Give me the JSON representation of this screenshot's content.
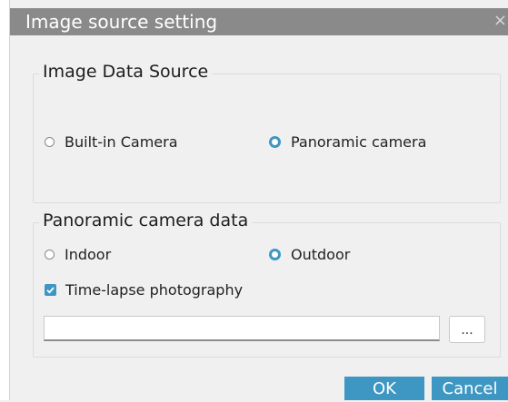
{
  "dialog": {
    "title": "Image source setting",
    "close_glyph": "×"
  },
  "image_data_source": {
    "title": "Image Data Source",
    "options": [
      {
        "label": "Built-in Camera",
        "checked": false
      },
      {
        "label": "Panoramic camera",
        "checked": true
      }
    ]
  },
  "panoramic_camera_data": {
    "title": "Panoramic camera data",
    "environment_options": [
      {
        "label": "Indoor",
        "checked": false
      },
      {
        "label": "Outdoor",
        "checked": true
      }
    ],
    "time_lapse": {
      "label": "Time-lapse photography",
      "checked": true
    },
    "path_value": "",
    "browse_label": "..."
  },
  "buttons": {
    "ok": "OK",
    "cancel": "Cancel"
  },
  "colors": {
    "accent": "#3d97c2",
    "titlebar": "#8a8a8a",
    "background": "#f0f0f0"
  },
  "icons": {
    "close": "close-icon",
    "check": "check-icon"
  }
}
